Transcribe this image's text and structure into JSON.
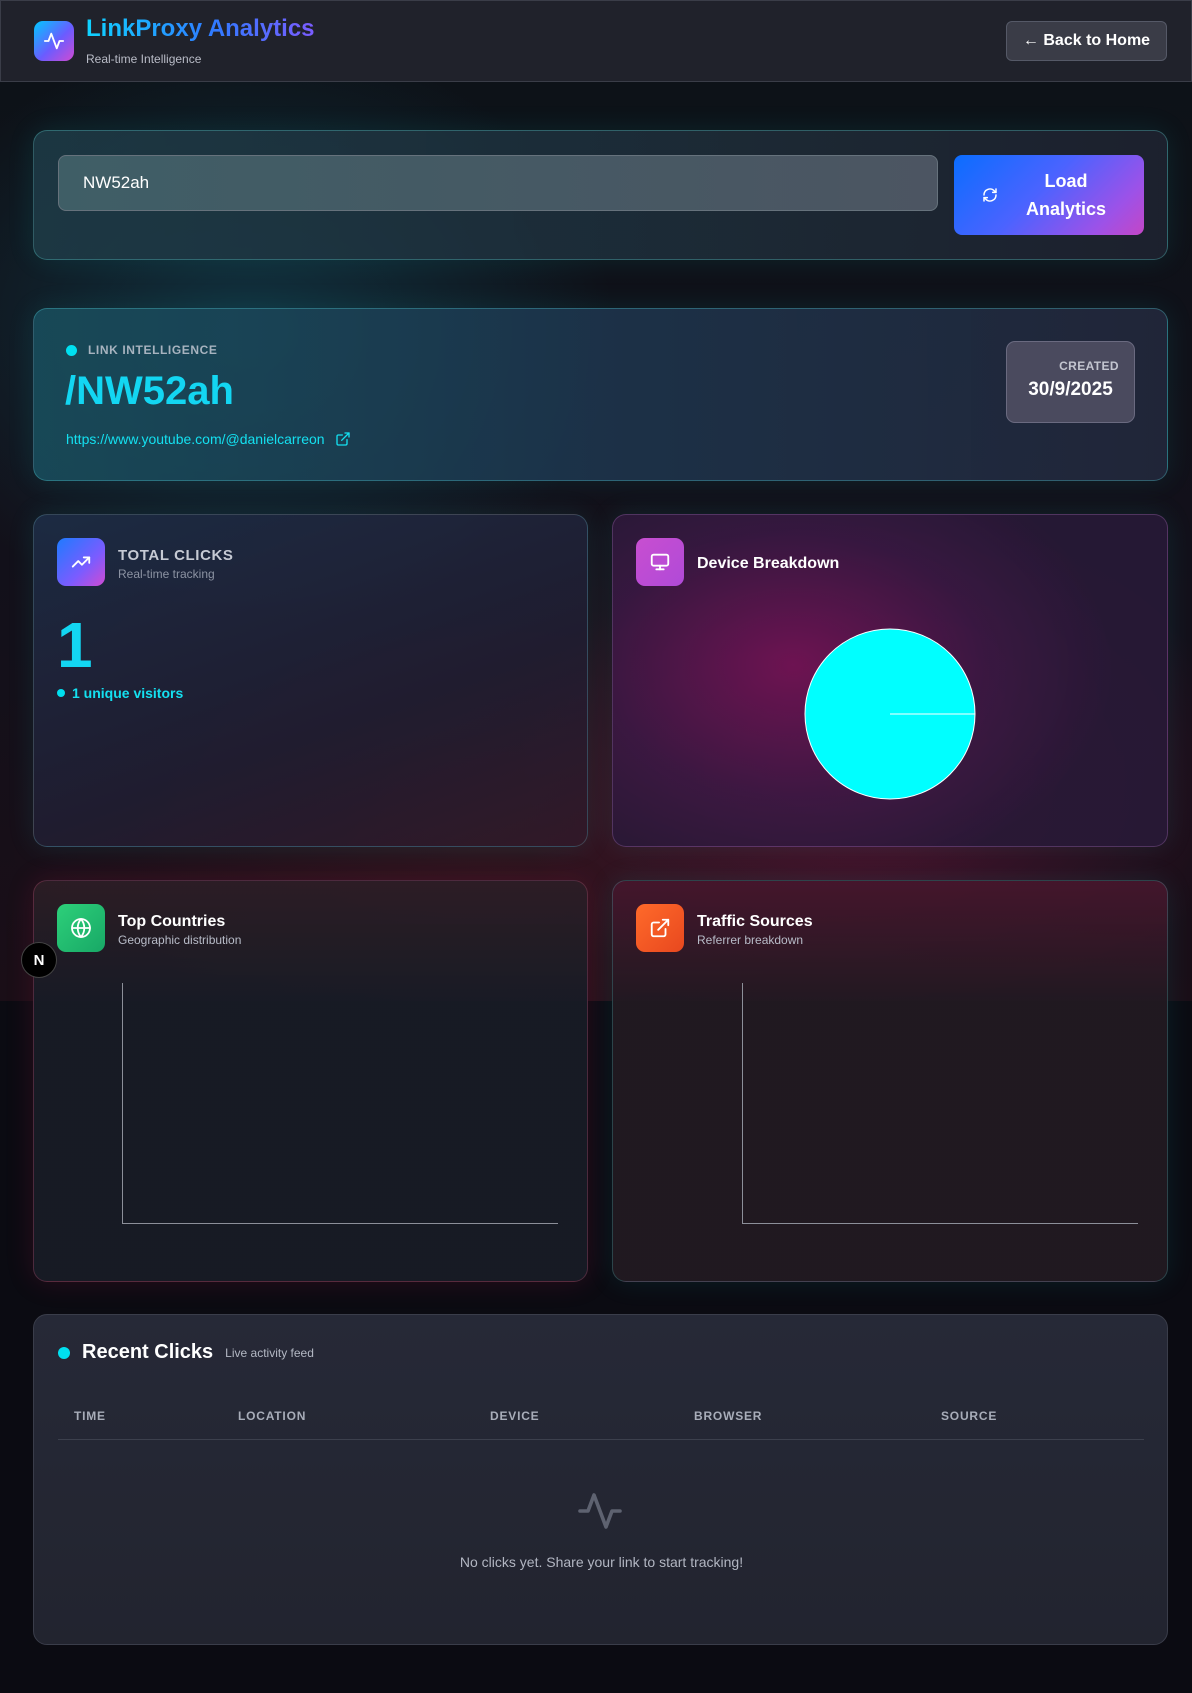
{
  "header": {
    "brand_title": "LinkProxy Analytics",
    "brand_subtitle": "Real-time Intelligence",
    "back_label": "← Back to Home"
  },
  "search": {
    "value": "NW52ah",
    "load_line1": "Load",
    "load_line2": "Analytics"
  },
  "intel": {
    "tag": "LINK INTELLIGENCE",
    "code": "/NW52ah",
    "url": "https://www.youtube.com/@danielcarreon",
    "created_label": "CREATED",
    "created_value": "30/9/2025"
  },
  "clicks": {
    "title": "TOTAL CLICKS",
    "subtitle": "Real-time tracking",
    "total": "1",
    "unique": "1 unique visitors"
  },
  "device": {
    "title": "Device Breakdown"
  },
  "countries": {
    "title": "Top Countries",
    "subtitle": "Geographic distribution"
  },
  "sources": {
    "title": "Traffic Sources",
    "subtitle": "Referrer breakdown"
  },
  "recent": {
    "title": "Recent Clicks",
    "subtitle": "Live activity feed",
    "columns": [
      "TIME",
      "LOCATION",
      "DEVICE",
      "BROWSER",
      "SOURCE"
    ],
    "empty_message": "No clicks yet. Share your link to start tracking!"
  },
  "badge": {
    "letter": "N"
  },
  "colors": {
    "accent_cyan": "#13d6f2",
    "pie_fill": "#00ffff",
    "background": "#0b0b12"
  },
  "chart_data": [
    {
      "type": "pie",
      "values": [
        1
      ]
    },
    {
      "type": "bar",
      "categories": [],
      "values": []
    },
    {
      "type": "bar",
      "categories": [],
      "values": []
    }
  ]
}
